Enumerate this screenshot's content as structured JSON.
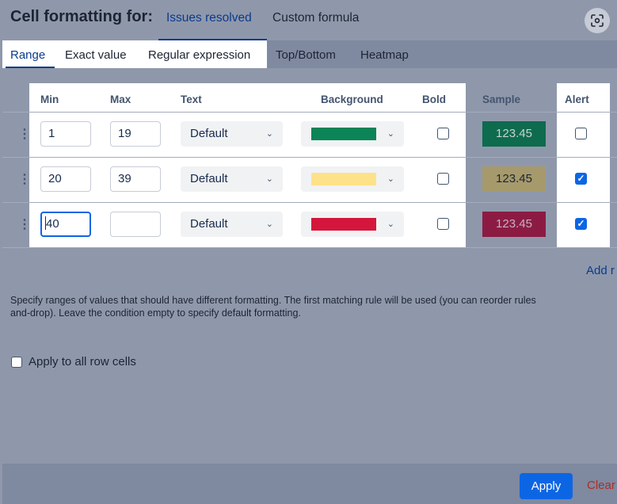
{
  "header": {
    "title": "Cell formatting for:",
    "tabs": [
      "Issues resolved",
      "Custom formula"
    ]
  },
  "subtabs": [
    "Range",
    "Exact value",
    "Regular expression",
    "Top/Bottom",
    "Heatmap"
  ],
  "columns": {
    "min": "Min",
    "max": "Max",
    "text": "Text",
    "background": "Background",
    "bold": "Bold",
    "sample": "Sample",
    "alert": "Alert"
  },
  "rows": [
    {
      "min": "1",
      "max": "19",
      "text": "Default",
      "background_color": "#0b8457",
      "bold": false,
      "sample": "123.45",
      "sample_bg": "#0e6b4e",
      "sample_fg": "#c9d3d0",
      "alert": false
    },
    {
      "min": "20",
      "max": "39",
      "text": "Default",
      "background_color": "#fde28a",
      "bold": false,
      "sample": "123.45",
      "sample_bg": "#a69a6c",
      "sample_fg": "#1d2433",
      "alert": true
    },
    {
      "min": "40",
      "max": "",
      "text": "Default",
      "background_color": "#d5163c",
      "bold": false,
      "sample": "123.45",
      "sample_bg": "#8c1b44",
      "sample_fg": "#c5b3c0",
      "alert": true
    }
  ],
  "add_rule": "Add r",
  "help": "Specify ranges of values that should have different formatting. The first matching rule will be used (you can reorder rules\nand-drop). Leave the condition empty to specify default formatting.",
  "apply_all": {
    "label": "Apply to all row cells",
    "checked": false
  },
  "footer": {
    "apply": "Apply",
    "clear": "Clear"
  },
  "colors": {
    "accent": "#0c66e4",
    "link": "#0b3a8c",
    "danger": "#ae2e24"
  }
}
